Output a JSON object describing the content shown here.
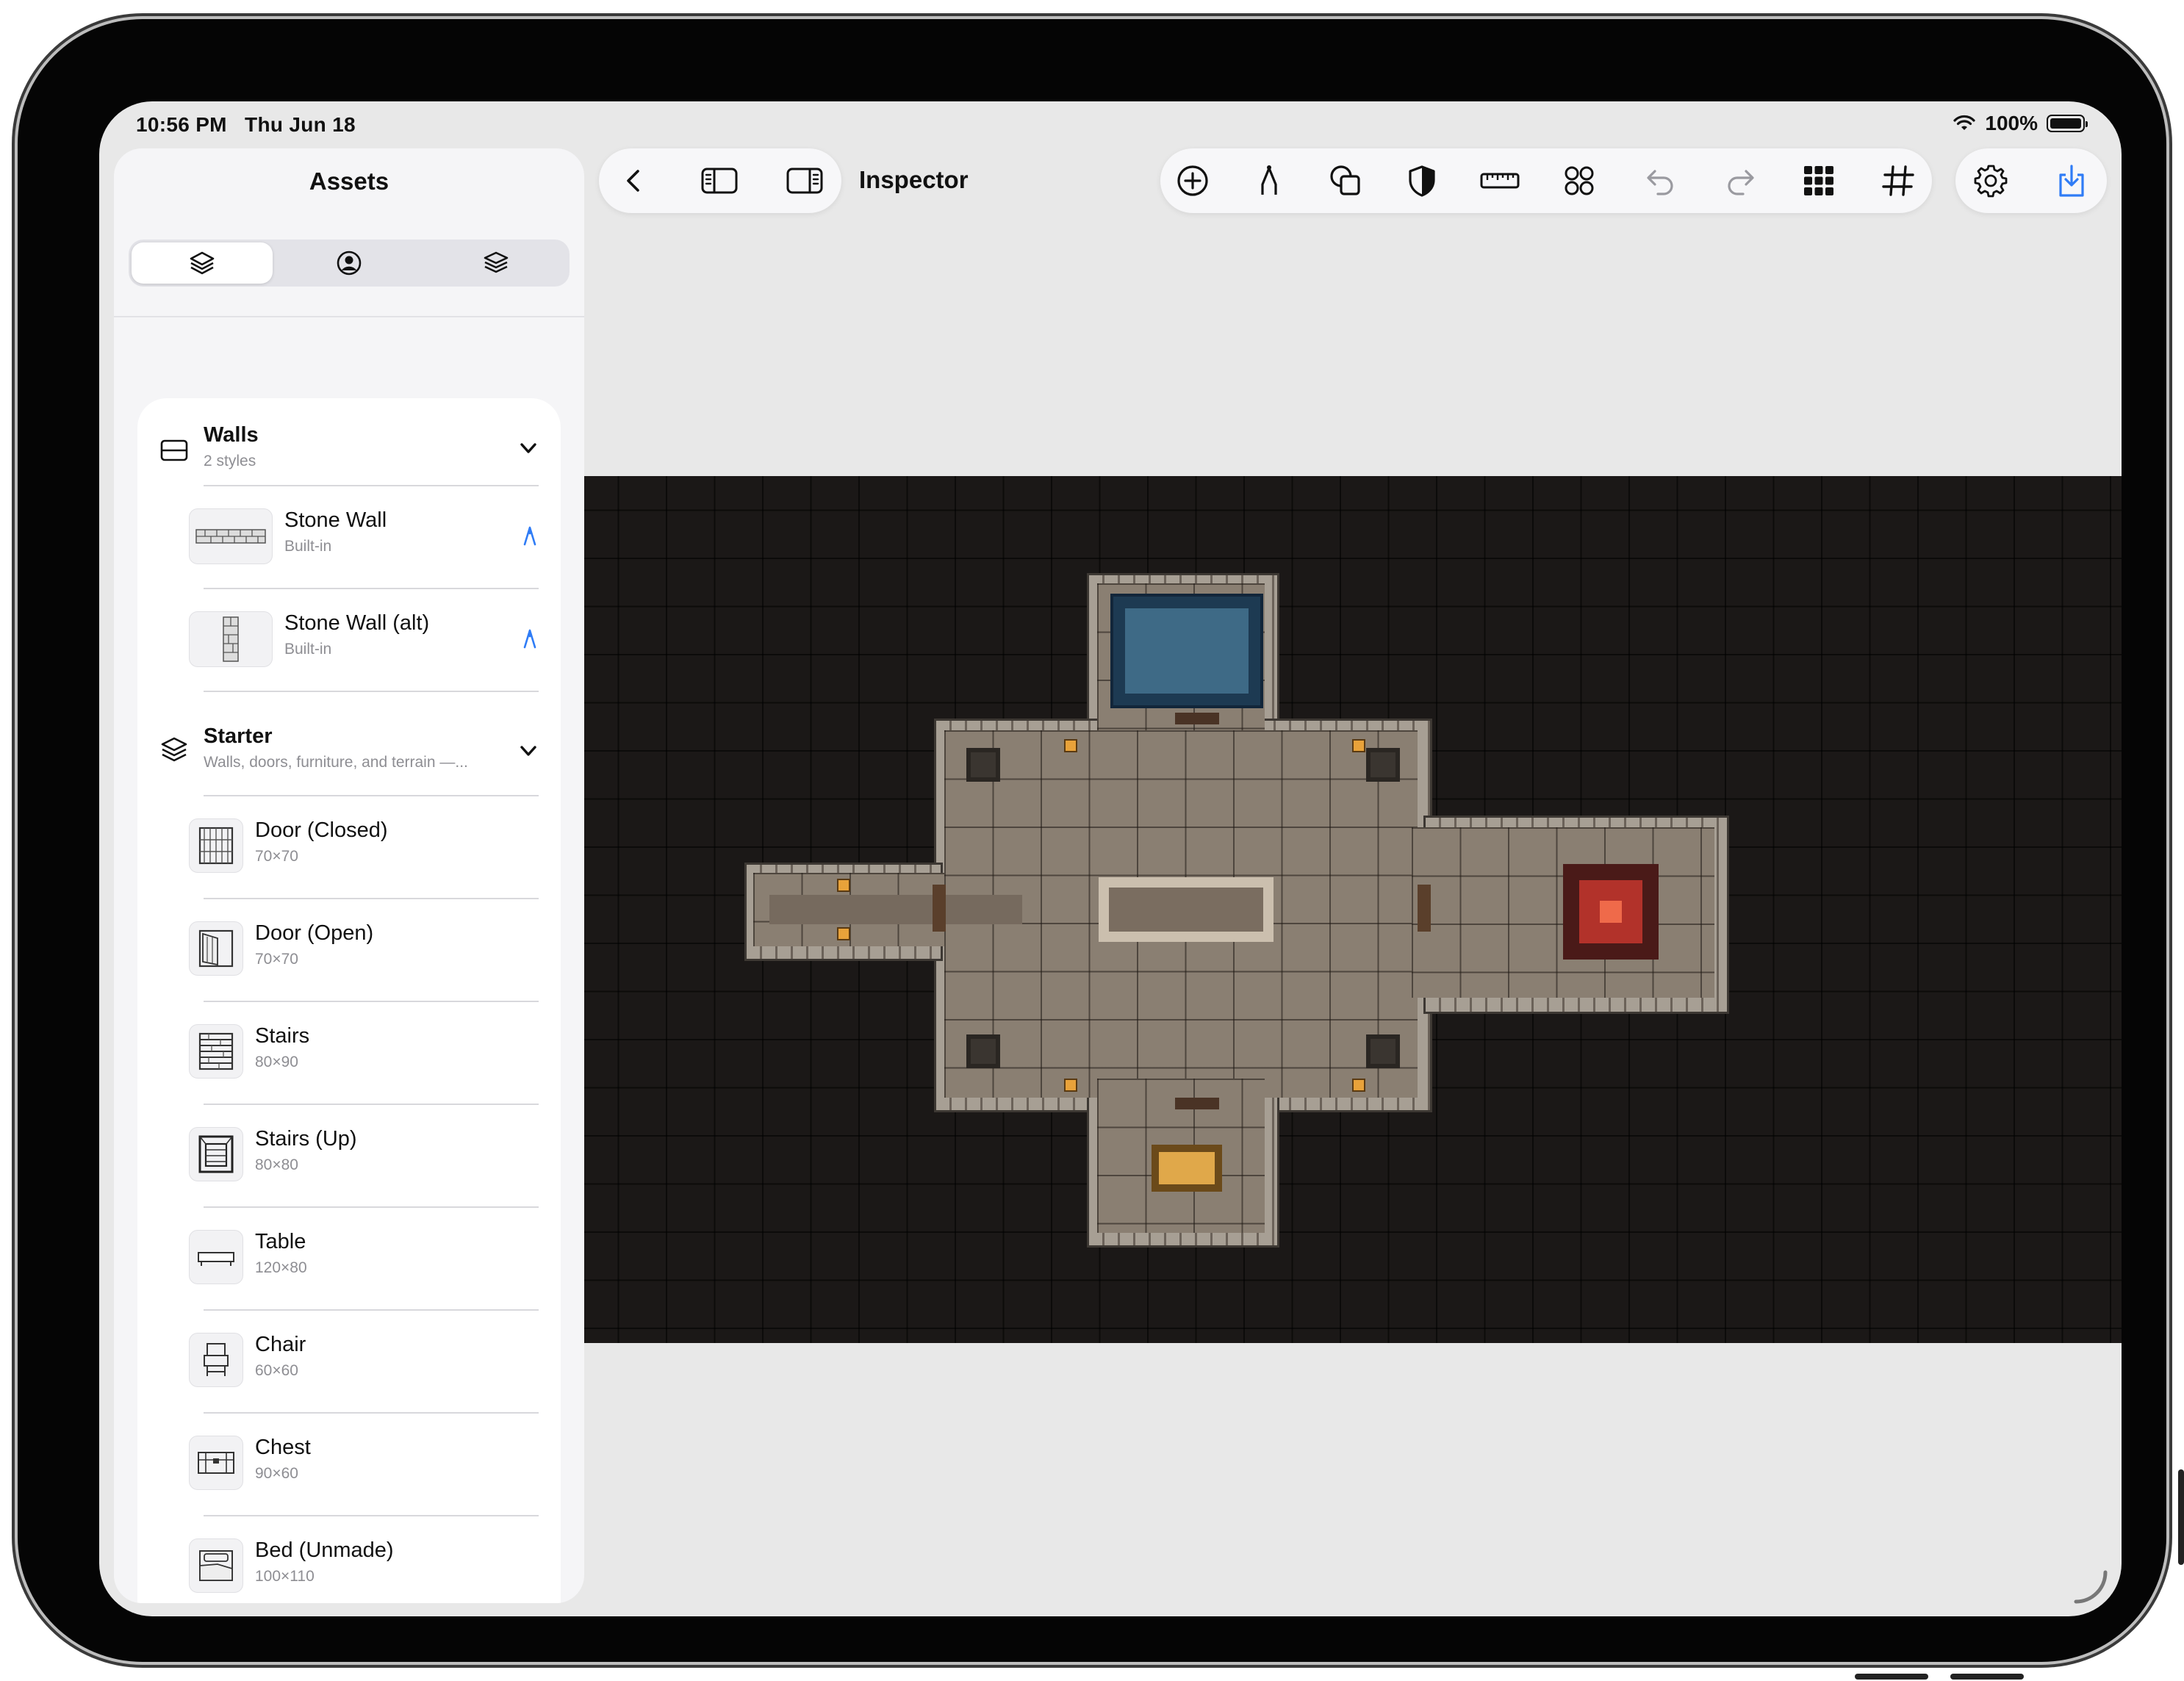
{
  "status_bar": {
    "time": "10:56 PM",
    "date": "Thu Jun 18",
    "battery": "100%"
  },
  "sidebar": {
    "title": "Assets",
    "segments": [
      "layers-icon",
      "person-circle-icon",
      "stack-icon"
    ],
    "groups": [
      {
        "title": "Walls",
        "subtitle": "2 styles",
        "items": [
          {
            "title": "Stone Wall",
            "subtitle": "Built-in"
          },
          {
            "title": "Stone Wall (alt)",
            "subtitle": "Built-in"
          }
        ]
      },
      {
        "title": "Starter",
        "subtitle": "Walls, doors, furniture, and terrain —...",
        "items": [
          {
            "title": "Door (Closed)",
            "subtitle": "70×70"
          },
          {
            "title": "Door (Open)",
            "subtitle": "70×70"
          },
          {
            "title": "Stairs",
            "subtitle": "80×90"
          },
          {
            "title": "Stairs (Up)",
            "subtitle": "80×80"
          },
          {
            "title": "Table",
            "subtitle": "120×80"
          },
          {
            "title": "Chair",
            "subtitle": "60×60"
          },
          {
            "title": "Chest",
            "subtitle": "90×60"
          },
          {
            "title": "Bed (Unmade)",
            "subtitle": "100×110"
          }
        ]
      }
    ]
  },
  "toolbar": {
    "inspector_label": "Inspector",
    "tools": [
      "add-icon",
      "pen-icon",
      "shapes-icon",
      "shield-icon",
      "ruler-icon",
      "four-circles-icon",
      "undo-icon",
      "redo-icon",
      "grid-3x3-icon",
      "hash-grid-icon"
    ],
    "actions": [
      "settings-icon",
      "export-icon"
    ]
  },
  "colors": {
    "accent": "#2f7cf6",
    "map_background": "#1b1817",
    "floor": "#8a7f72"
  }
}
